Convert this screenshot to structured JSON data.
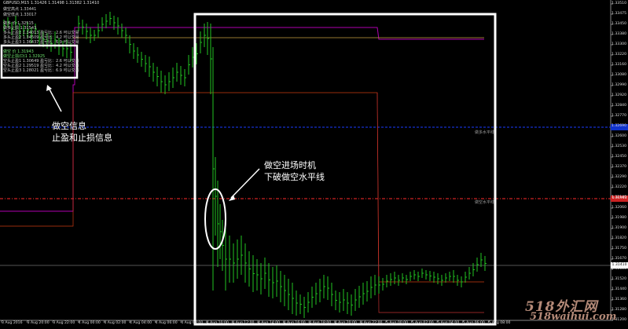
{
  "symbol_line": "GBPUSD,M15  1.31426 1.31498 1.31382 1.31410",
  "info_top": [
    "做空高点 1.33441",
    "做空低点 1.33017"
  ],
  "info_long": [
    "做多 价 1.32515",
    "做多止损 1.31543",
    "多头止盈1 1.34013  盈亏比：2.6  可以交易",
    "多头止盈2 1.34509  盈亏比：4.2  可以交易",
    "多头止盈3 1.36437  盈亏比：6.9  可以交易"
  ],
  "info_short": [
    "做空 价 1.31943",
    "做空止损(D)1 1.32925",
    "空头止盈1 1.30649  盈亏比：2.6  可以交易",
    "空头止盈2 1.29519  盈亏比：4.2  可以交易",
    "空头止盈3 1.28021  盈亏比：6.9  可以交易"
  ],
  "annotation_left": [
    "做空信息",
    "止盈和止损信息"
  ],
  "annotation_mid": [
    "做空进场时机",
    "下破做空水平线"
  ],
  "level_long_label": "做多水平线",
  "level_short_label": "做空水平线",
  "y_axis_labels": [
    "1.33510",
    "1.33475",
    "1.33450",
    "1.33380",
    "1.33300",
    "1.33220",
    "1.33160",
    "1.33080",
    "1.32990",
    "1.32920",
    "1.32840",
    "1.32770",
    "1.32690",
    "1.32600",
    "1.32530",
    "1.32450",
    "1.32370",
    "1.32290",
    "1.32220",
    "1.32140",
    "1.32060",
    "1.31980",
    "1.31900",
    "1.31820",
    "1.31750",
    "1.31670",
    "1.31600",
    "1.31520",
    "1.31440",
    "1.31360",
    "1.31280",
    "1.31200"
  ],
  "price_tag_short": "1.31943",
  "price_tag_current": "1.31410",
  "x_axis_labels": [
    "3 Aug 2016",
    "3 Aug 20:00",
    "3 Aug 22:00",
    "4 Aug 00:00",
    "4 Aug 02:00",
    "4 Aug 04:00",
    "4 Aug 06:00",
    "4 Aug 08:00",
    "4 Aug 10:00",
    "4 Aug 12:00",
    "4 Aug 14:00",
    "4 Aug 16:00",
    "4 Aug 18:00",
    "4 Aug 20:00",
    "4 Aug 22:00",
    "5 Aug 00:00",
    "5 Aug 02:00",
    "5 Aug 04:00",
    "5 Aug 06:00",
    "5 Aug 08:00"
  ],
  "watermark": {
    "big": "518外汇网",
    "small": "518waihui.com"
  },
  "colors": {
    "bars": "#22c322",
    "long_level": "#1a3cff",
    "short_level": "#ff2a2a",
    "stop": "#b000b0",
    "takeprofit": "#e05010",
    "gold": "#c8a040",
    "annotation_box": "#ffffff"
  }
}
